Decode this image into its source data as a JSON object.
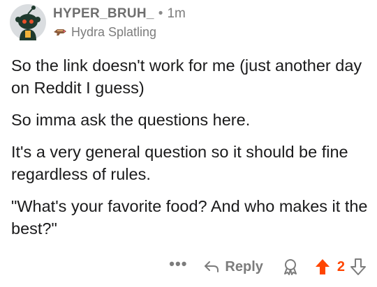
{
  "comment": {
    "username": "HYPER_BRUH_",
    "separator": "•",
    "time": "1m",
    "flair": {
      "text": "Hydra Splatling",
      "icon": "hydra-splatling-icon"
    },
    "avatar": "reddit-snoo-avatar",
    "paragraphs": [
      "So the link doesn't work for me (just another day on Reddit I guess)",
      "So imma ask the questions here.",
      "It's a very general question so it should be fine regardless of rules.",
      "\"What's your favorite food? And who makes it the best?\""
    ]
  },
  "actions": {
    "more": "•••",
    "reply_label": "Reply",
    "score": "2"
  },
  "colors": {
    "upvote": "#ff4500",
    "meta_text": "#7c7c7c",
    "body_text": "#1a1a1b"
  }
}
